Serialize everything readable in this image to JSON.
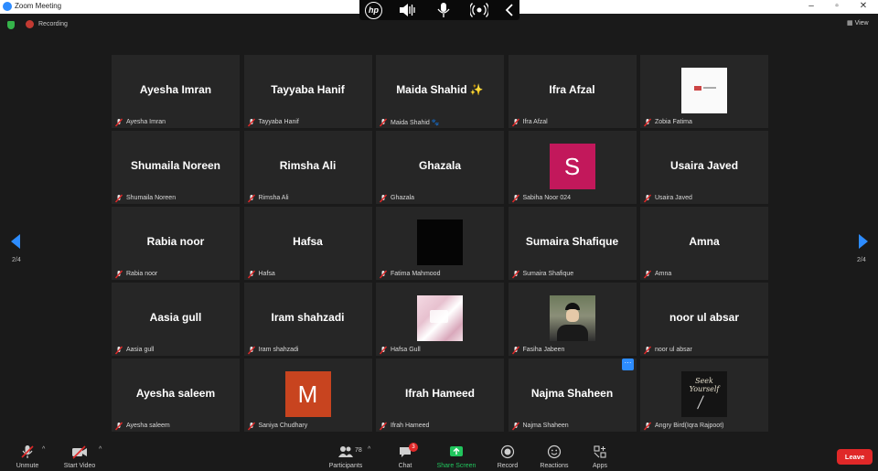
{
  "window": {
    "title": "Zoom Meeting"
  },
  "topbar": {
    "recording_label": "Recording",
    "view_label": "View"
  },
  "hp_toolbar": {
    "logo_text": "hp"
  },
  "participants": [
    {
      "display": "Ayesha Imran",
      "label": "Ayesha Imran"
    },
    {
      "display": "Tayyaba Hanif",
      "label": "Tayyaba Hanif"
    },
    {
      "display": "Maida  Shahid ✨",
      "label": "Maida Shahid 🐾"
    },
    {
      "display": "Ifra Afzal",
      "label": "Ifra Afzal"
    },
    {
      "display": "",
      "label": "Zobia Fatima",
      "avatar": "image-white"
    },
    {
      "display": "Shumaila Noreen",
      "label": "Shumaila Noreen"
    },
    {
      "display": "Rimsha Ali",
      "label": "Rimsha Ali"
    },
    {
      "display": "Ghazala",
      "label": "Ghazala"
    },
    {
      "display": "",
      "label": "Sabiha Noor 024",
      "avatar": "letter",
      "letter": "S",
      "color": "#c2185b"
    },
    {
      "display": "Usaira Javed",
      "label": "Usaira Javed"
    },
    {
      "display": "Rabia noor",
      "label": "Rabia noor"
    },
    {
      "display": "Hafsa",
      "label": "Hafsa"
    },
    {
      "display": "",
      "label": "Fatima Mahmood",
      "avatar": "image-black"
    },
    {
      "display": "Sumaira Shafique",
      "label": "Sumaira Shafique"
    },
    {
      "display": "Amna",
      "label": "Amna"
    },
    {
      "display": "Aasia gull",
      "label": "Aasia gull"
    },
    {
      "display": "Iram shahzadi",
      "label": "Iram shahzadi"
    },
    {
      "display": "",
      "label": "Hafsa Gull",
      "avatar": "image-floral"
    },
    {
      "display": "",
      "label": "Fasiha Jabeen",
      "avatar": "image-portrait"
    },
    {
      "display": "noor ul absar",
      "label": "noor ul absar"
    },
    {
      "display": "Ayesha saleem",
      "label": "Ayesha saleem"
    },
    {
      "display": "",
      "label": "Saniya Chudhary",
      "avatar": "letter",
      "letter": "M",
      "color": "#c8441f"
    },
    {
      "display": "Ifrah Hameed",
      "label": "Ifrah Hameed"
    },
    {
      "display": "Najma Shaheen",
      "label": "Najma Shaheen"
    },
    {
      "display": "",
      "label": "Angry Bird(Iqra Rajpoot)",
      "avatar": "image-seek",
      "avatar_text": "Seek Yourself"
    }
  ],
  "pagination": {
    "left": "2/4",
    "right": "2/4"
  },
  "toolbar": {
    "unmute": "Unmute",
    "start_video": "Start Video",
    "participants": "Participants",
    "participants_count": "78",
    "chat": "Chat",
    "chat_badge": "3",
    "share_screen": "Share Screen",
    "record": "Record",
    "reactions": "Reactions",
    "apps": "Apps",
    "leave": "Leave"
  },
  "colors": {
    "accent": "#2d8cff",
    "leave": "#e02828",
    "share": "#21c55d",
    "tile_bg": "#262626"
  }
}
